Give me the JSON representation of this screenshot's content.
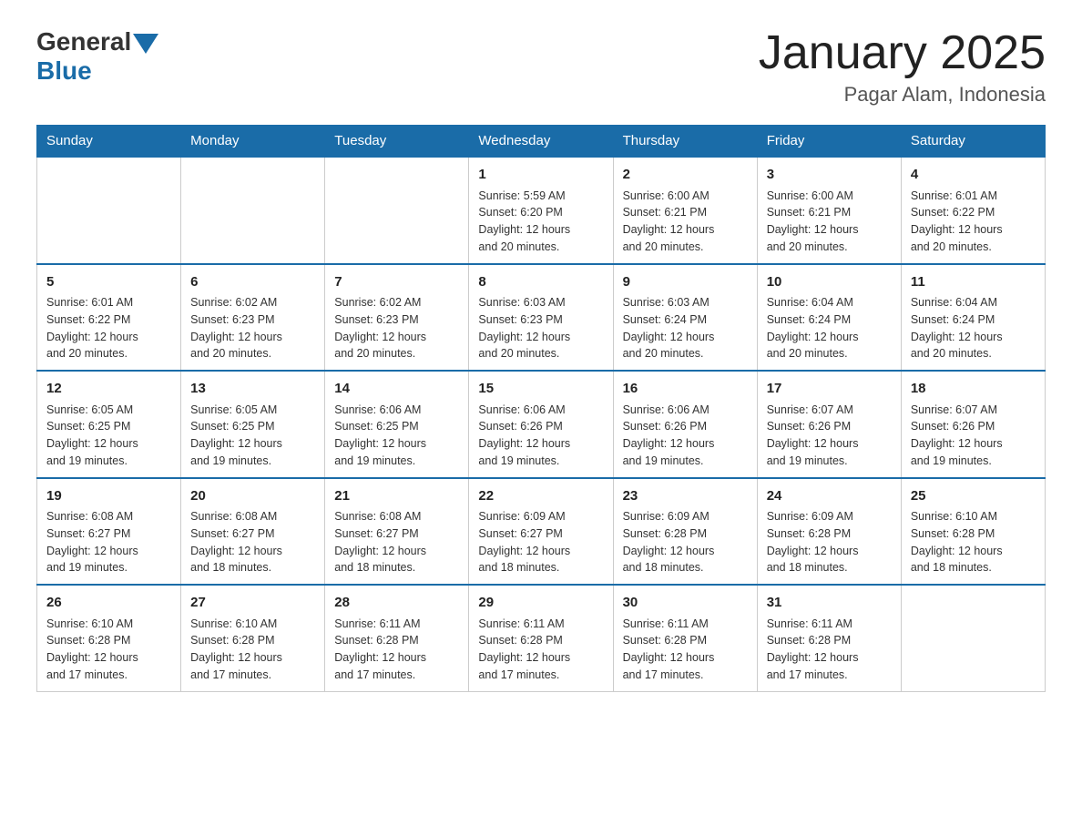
{
  "header": {
    "title": "January 2025",
    "subtitle": "Pagar Alam, Indonesia",
    "logo_general": "General",
    "logo_blue": "Blue"
  },
  "weekdays": [
    "Sunday",
    "Monday",
    "Tuesday",
    "Wednesday",
    "Thursday",
    "Friday",
    "Saturday"
  ],
  "weeks": [
    [
      {
        "day": "",
        "info": ""
      },
      {
        "day": "",
        "info": ""
      },
      {
        "day": "",
        "info": ""
      },
      {
        "day": "1",
        "info": "Sunrise: 5:59 AM\nSunset: 6:20 PM\nDaylight: 12 hours\nand 20 minutes."
      },
      {
        "day": "2",
        "info": "Sunrise: 6:00 AM\nSunset: 6:21 PM\nDaylight: 12 hours\nand 20 minutes."
      },
      {
        "day": "3",
        "info": "Sunrise: 6:00 AM\nSunset: 6:21 PM\nDaylight: 12 hours\nand 20 minutes."
      },
      {
        "day": "4",
        "info": "Sunrise: 6:01 AM\nSunset: 6:22 PM\nDaylight: 12 hours\nand 20 minutes."
      }
    ],
    [
      {
        "day": "5",
        "info": "Sunrise: 6:01 AM\nSunset: 6:22 PM\nDaylight: 12 hours\nand 20 minutes."
      },
      {
        "day": "6",
        "info": "Sunrise: 6:02 AM\nSunset: 6:23 PM\nDaylight: 12 hours\nand 20 minutes."
      },
      {
        "day": "7",
        "info": "Sunrise: 6:02 AM\nSunset: 6:23 PM\nDaylight: 12 hours\nand 20 minutes."
      },
      {
        "day": "8",
        "info": "Sunrise: 6:03 AM\nSunset: 6:23 PM\nDaylight: 12 hours\nand 20 minutes."
      },
      {
        "day": "9",
        "info": "Sunrise: 6:03 AM\nSunset: 6:24 PM\nDaylight: 12 hours\nand 20 minutes."
      },
      {
        "day": "10",
        "info": "Sunrise: 6:04 AM\nSunset: 6:24 PM\nDaylight: 12 hours\nand 20 minutes."
      },
      {
        "day": "11",
        "info": "Sunrise: 6:04 AM\nSunset: 6:24 PM\nDaylight: 12 hours\nand 20 minutes."
      }
    ],
    [
      {
        "day": "12",
        "info": "Sunrise: 6:05 AM\nSunset: 6:25 PM\nDaylight: 12 hours\nand 19 minutes."
      },
      {
        "day": "13",
        "info": "Sunrise: 6:05 AM\nSunset: 6:25 PM\nDaylight: 12 hours\nand 19 minutes."
      },
      {
        "day": "14",
        "info": "Sunrise: 6:06 AM\nSunset: 6:25 PM\nDaylight: 12 hours\nand 19 minutes."
      },
      {
        "day": "15",
        "info": "Sunrise: 6:06 AM\nSunset: 6:26 PM\nDaylight: 12 hours\nand 19 minutes."
      },
      {
        "day": "16",
        "info": "Sunrise: 6:06 AM\nSunset: 6:26 PM\nDaylight: 12 hours\nand 19 minutes."
      },
      {
        "day": "17",
        "info": "Sunrise: 6:07 AM\nSunset: 6:26 PM\nDaylight: 12 hours\nand 19 minutes."
      },
      {
        "day": "18",
        "info": "Sunrise: 6:07 AM\nSunset: 6:26 PM\nDaylight: 12 hours\nand 19 minutes."
      }
    ],
    [
      {
        "day": "19",
        "info": "Sunrise: 6:08 AM\nSunset: 6:27 PM\nDaylight: 12 hours\nand 19 minutes."
      },
      {
        "day": "20",
        "info": "Sunrise: 6:08 AM\nSunset: 6:27 PM\nDaylight: 12 hours\nand 18 minutes."
      },
      {
        "day": "21",
        "info": "Sunrise: 6:08 AM\nSunset: 6:27 PM\nDaylight: 12 hours\nand 18 minutes."
      },
      {
        "day": "22",
        "info": "Sunrise: 6:09 AM\nSunset: 6:27 PM\nDaylight: 12 hours\nand 18 minutes."
      },
      {
        "day": "23",
        "info": "Sunrise: 6:09 AM\nSunset: 6:28 PM\nDaylight: 12 hours\nand 18 minutes."
      },
      {
        "day": "24",
        "info": "Sunrise: 6:09 AM\nSunset: 6:28 PM\nDaylight: 12 hours\nand 18 minutes."
      },
      {
        "day": "25",
        "info": "Sunrise: 6:10 AM\nSunset: 6:28 PM\nDaylight: 12 hours\nand 18 minutes."
      }
    ],
    [
      {
        "day": "26",
        "info": "Sunrise: 6:10 AM\nSunset: 6:28 PM\nDaylight: 12 hours\nand 17 minutes."
      },
      {
        "day": "27",
        "info": "Sunrise: 6:10 AM\nSunset: 6:28 PM\nDaylight: 12 hours\nand 17 minutes."
      },
      {
        "day": "28",
        "info": "Sunrise: 6:11 AM\nSunset: 6:28 PM\nDaylight: 12 hours\nand 17 minutes."
      },
      {
        "day": "29",
        "info": "Sunrise: 6:11 AM\nSunset: 6:28 PM\nDaylight: 12 hours\nand 17 minutes."
      },
      {
        "day": "30",
        "info": "Sunrise: 6:11 AM\nSunset: 6:28 PM\nDaylight: 12 hours\nand 17 minutes."
      },
      {
        "day": "31",
        "info": "Sunrise: 6:11 AM\nSunset: 6:28 PM\nDaylight: 12 hours\nand 17 minutes."
      },
      {
        "day": "",
        "info": ""
      }
    ]
  ]
}
